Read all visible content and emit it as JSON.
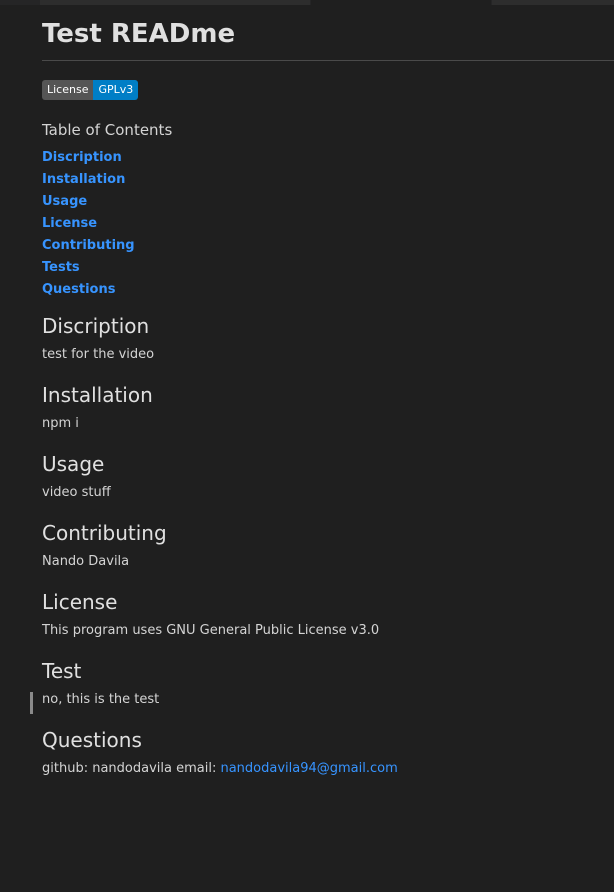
{
  "document": {
    "title": "Test READme",
    "badge": {
      "left": "License",
      "right": "GPLv3",
      "left_color": "#555555",
      "right_color": "#007ec6"
    },
    "toc": {
      "title": "Table of Contents",
      "items": [
        "Discription",
        "Installation",
        "Usage",
        "License",
        "Contributing",
        "Tests",
        "Questions"
      ]
    },
    "sections": {
      "description": {
        "heading": "Discription",
        "text": "test for the video"
      },
      "installation": {
        "heading": "Installation",
        "text": "npm i"
      },
      "usage": {
        "heading": "Usage",
        "text": "video stuff"
      },
      "contributing": {
        "heading": "Contributing",
        "text": "Nando Davila"
      },
      "license": {
        "heading": "License",
        "text": "This program uses GNU General Public License v3.0"
      },
      "test": {
        "heading": "Test",
        "text": "no, this is the test"
      },
      "questions": {
        "heading": "Questions",
        "text": "github: nandodavila email: ",
        "email": "nandodavila94@gmail.com"
      }
    },
    "colors": {
      "background": "#1f1f1f",
      "text": "#d4d4d4",
      "link": "#3794ff"
    }
  }
}
